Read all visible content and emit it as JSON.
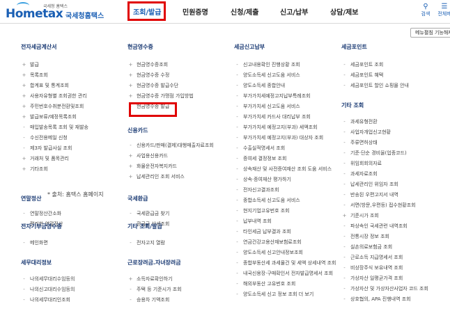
{
  "header": {
    "logo_sub": "국세청 홈택스",
    "logo_main": "Hometax",
    "logo_korean": "국세청홈택스",
    "nav": [
      {
        "label": "조회/발급",
        "active": true
      },
      {
        "label": "민원증명",
        "active": false
      },
      {
        "label": "신청/제출",
        "active": false
      },
      {
        "label": "신고/납부",
        "active": false
      },
      {
        "label": "상담/제보",
        "active": false
      }
    ],
    "search_label": "검색",
    "allmenu_label": "전체메"
  },
  "shortcut_label": "메뉴펼침 기능해제",
  "source_note": "* 출처: 홈택스 홈페이지",
  "col1": {
    "sections": [
      {
        "title": "전자세금계산서",
        "items": [
          {
            "label": "발급",
            "marker": "+"
          },
          {
            "label": "목록조회",
            "marker": "+"
          },
          {
            "label": "합계표 및 통계조회",
            "marker": "+"
          },
          {
            "label": "사용자유형별 조회권한 관리",
            "marker": "+"
          },
          {
            "label": "주민번호수취분전환및조회",
            "marker": "+"
          },
          {
            "label": "발급보류/예정목록조회",
            "marker": "+"
          },
          {
            "label": "매입발송목록 조회 및 재발송",
            "marker": "-"
          },
          {
            "label": "수신전용메일 신청",
            "marker": "-"
          },
          {
            "label": "제3자 발급사실 조회",
            "marker": "-"
          },
          {
            "label": "거래처 및 품목관리",
            "marker": "+"
          },
          {
            "label": "기타조회",
            "marker": "+"
          }
        ]
      },
      {
        "title": "연말정산",
        "items": [
          {
            "label": "연말정산간소화",
            "marker": "-"
          },
          {
            "label": "편리한 연말정산",
            "marker": "-"
          }
        ]
      },
      {
        "title": "전자기부금영수증",
        "items": [
          {
            "label": "메인화면",
            "marker": "-"
          }
        ]
      },
      {
        "title": "세무대리정보",
        "items": [
          {
            "label": "나의세무대리수임등의",
            "marker": "-"
          },
          {
            "label": "나의신고대리수임등의",
            "marker": "-"
          },
          {
            "label": "나의세무대리인조회",
            "marker": "-"
          }
        ]
      }
    ]
  },
  "col2": {
    "sections": [
      {
        "title": "현금영수증",
        "items": [
          {
            "label": "현금영수증조회",
            "marker": "+"
          },
          {
            "label": "현금영수증 수정",
            "marker": "+"
          },
          {
            "label": "현금영수증 발급수단",
            "marker": "+"
          },
          {
            "label": "현금영수증 가맹점 가입방법",
            "marker": "+"
          },
          {
            "label": "현금영수증 발급",
            "marker": "-"
          }
        ]
      },
      {
        "title": "신용카드",
        "items": [
          {
            "label": "신용카드/판매(결제)대행매출자료조회",
            "marker": "-"
          },
          {
            "label": "사업용신용카드",
            "marker": "+"
          },
          {
            "label": "화물운전자복지카드",
            "marker": "+"
          },
          {
            "label": "납세관리인 조회 서비스",
            "marker": "+"
          }
        ]
      },
      {
        "title": "국세환급",
        "items": [
          {
            "label": "국세환급금 찾기",
            "marker": "-"
          },
          {
            "label": "환급금 상세조회",
            "marker": "-"
          }
        ]
      },
      {
        "title": "기타 조회/발급",
        "items": [
          {
            "label": "전자고지 열람",
            "marker": "-"
          }
        ]
      },
      {
        "title": "근로장려금.자녀장려금",
        "items": [
          {
            "label": "소득자료확인하기",
            "marker": "+"
          },
          {
            "label": "주택 등 기준시가 조회",
            "marker": "-"
          },
          {
            "label": "승용차 기액조회",
            "marker": "-"
          }
        ]
      }
    ]
  },
  "col3": {
    "sections": [
      {
        "title": "세금신고납부",
        "items": [
          {
            "label": "신고내용확인 진행상황 조회",
            "marker": "-"
          },
          {
            "label": "양도소득세 신고도움 서비스",
            "marker": "-"
          },
          {
            "label": "양도소득세 종합안내",
            "marker": "-"
          },
          {
            "label": "부가가치세예정고지납부특례조회",
            "marker": "-"
          },
          {
            "label": "부가가치세 신고도움 서비스",
            "marker": "-"
          },
          {
            "label": "부가가치세 카드사 대리납부 조회",
            "marker": "-"
          },
          {
            "label": "부가가치세 예정고지(부과) 세액조회",
            "marker": "-"
          },
          {
            "label": "부가가치세 예정고지(부과) 대상자 조회",
            "marker": "-"
          },
          {
            "label": "수출실적명세서 조회",
            "marker": "-"
          },
          {
            "label": "증여세 결정정보 조회",
            "marker": "-"
          },
          {
            "label": "상속재산 및 사전증여재산 조회 도움 서비스",
            "marker": "-"
          },
          {
            "label": "상속·증여재산 평가하기",
            "marker": "-"
          },
          {
            "label": "전자신고결과조회",
            "marker": "-"
          },
          {
            "label": "종합소득세 신고도움 서비스",
            "marker": "-"
          },
          {
            "label": "현지기업고유번호 조회",
            "marker": "-"
          },
          {
            "label": "납부내역 조회",
            "marker": "-"
          },
          {
            "label": "타인세금 납부결과 조회",
            "marker": "-"
          },
          {
            "label": "연금건강고용산재보험료조회",
            "marker": "-"
          },
          {
            "label": "양도소득세 신고안내정보조회",
            "marker": "-"
          },
          {
            "label": "종합부동산세 과세물건 및 세액 상세내역 조회",
            "marker": "-"
          },
          {
            "label": "내국신용장·구매확인서 전자발급명세서 조회",
            "marker": "-"
          },
          {
            "label": "해외부동산 고유번호 조회",
            "marker": "-"
          },
          {
            "label": "양도소득세 신고 정보 조회 더 보기",
            "marker": "-"
          }
        ]
      }
    ]
  },
  "col4": {
    "sections": [
      {
        "title": "세금포인트",
        "items": [
          {
            "label": "세금포인트 조회",
            "marker": "-"
          },
          {
            "label": "세금포인트 혜택",
            "marker": "-"
          },
          {
            "label": "세금포인트 할인 쇼핑몰 안내",
            "marker": "-"
          }
        ]
      },
      {
        "title": "기타 조회",
        "items": [
          {
            "label": "과세유형전환",
            "marker": "-"
          },
          {
            "label": "사업자개업신고현황",
            "marker": "-"
          },
          {
            "label": "주류면허상태",
            "marker": "-"
          },
          {
            "label": "기준·단순 경비율(업종코드)",
            "marker": "-"
          },
          {
            "label": "위임회회의자료",
            "marker": "-"
          },
          {
            "label": "과세자료조회",
            "marker": "-"
          },
          {
            "label": "납세관리인 위임자 조회",
            "marker": "-"
          },
          {
            "label": "반송된 우편고지서 내역",
            "marker": "-"
          },
          {
            "label": "서면(방문,우편등) 접수현황조회",
            "marker": "-"
          },
          {
            "label": "기준시가 조회",
            "marker": "+"
          },
          {
            "label": "파상속인 국세관련 내역조회",
            "marker": "-"
          },
          {
            "label": "전통시장 정보 조회",
            "marker": "-"
          },
          {
            "label": "실손의료보험금 조회",
            "marker": "-"
          },
          {
            "label": "근로소득 지급명세서 조회",
            "marker": "-"
          },
          {
            "label": "비상장주식 보유내역 조회",
            "marker": "-"
          },
          {
            "label": "가상자산 일평균가격 조회",
            "marker": "-"
          },
          {
            "label": "가상자산 및 가상자산사업자 코드 조회",
            "marker": "-"
          },
          {
            "label": "상호협의, APA 진행내역 조회",
            "marker": "-"
          }
        ]
      }
    ]
  }
}
